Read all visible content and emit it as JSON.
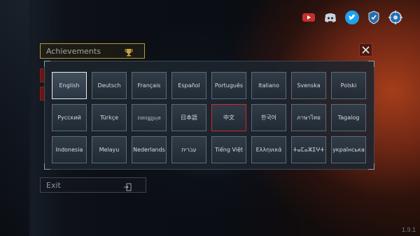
{
  "menu": {
    "achievements_label": "Achievements",
    "exit_label": "Exit"
  },
  "social_icons": [
    "youtube-icon",
    "discord-icon",
    "twitter-icon",
    "shield-icon",
    "settings-badge-icon"
  ],
  "languages": [
    "English",
    "Deutsch",
    "Français",
    "Español",
    "Português",
    "Italiano",
    "Svenska",
    "Polski",
    "Русский",
    "Türkçe",
    "ꤊꤢꤛꤢ꤭ꤜꤟꤤ",
    "日本語",
    "中文",
    "한국어",
    "ภาษาไทย",
    "Tagalog",
    "Indonesia",
    "Melayu",
    "Nederlands",
    "עברית",
    "Tiếng Việt",
    "Ελληνικά",
    "ⵜⴰⵎⴰⵣⵉⵖⵜ",
    "українська"
  ],
  "selected_language": "English",
  "highlighted_language": "中文",
  "version": "1.9.1",
  "colors": {
    "highlight_border": "#d02a2a",
    "selected_border": "#e8eef2",
    "achievements_border": "#b79a39"
  }
}
